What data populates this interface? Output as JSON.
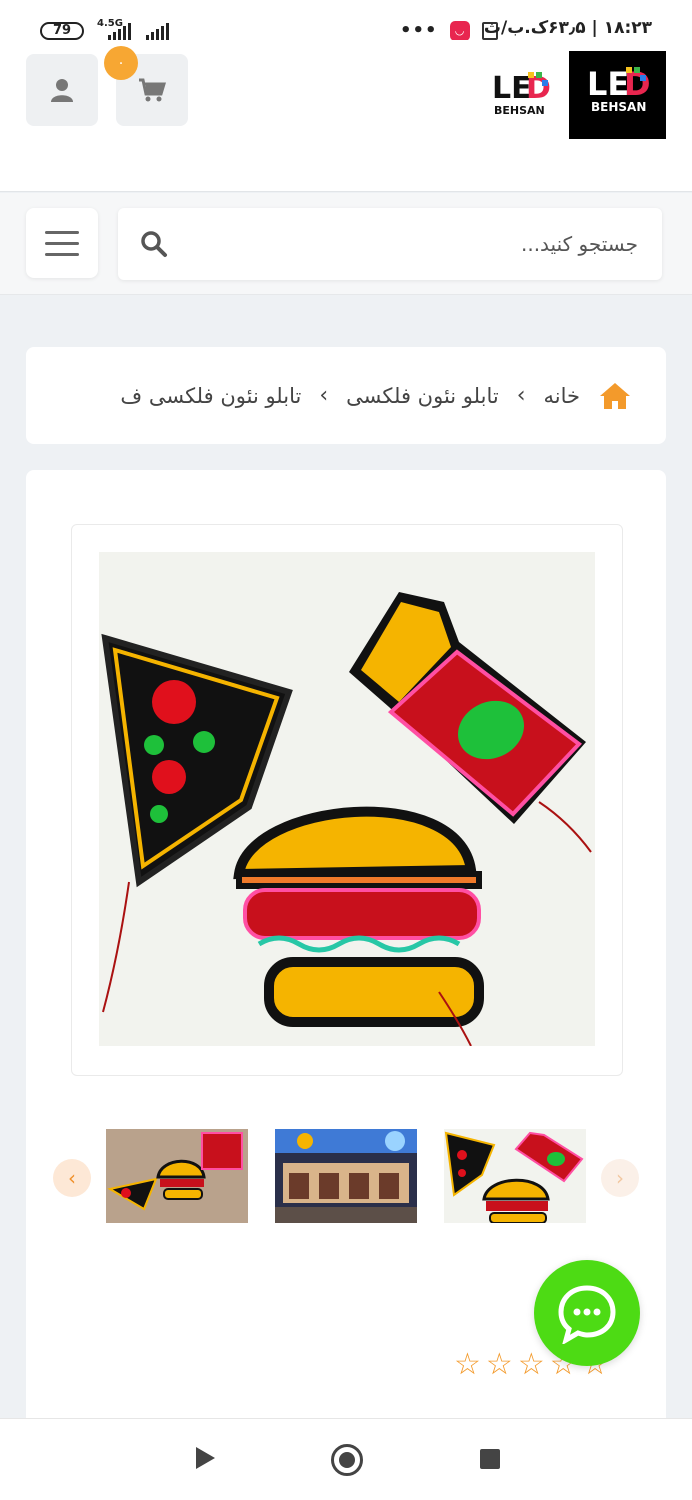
{
  "status_bar": {
    "battery": "79",
    "network": "4.5G",
    "time_info": "۱۸:۲۳ | ۶۳٫۵ک.ب/ث",
    "more": "•••"
  },
  "header": {
    "cart_count": "۰",
    "logo_text_top": "LED",
    "logo_text_bottom": "BEHSAN"
  },
  "search": {
    "placeholder": "جستجو کنید..."
  },
  "breadcrumb": {
    "items": [
      "خانه",
      "تابلو نئون فلکسی",
      "تابلو نئون فلکسی ف"
    ]
  },
  "product": {
    "image_alt": "neon pizza burger fries signs",
    "thumbnails": [
      "thumbnail-1",
      "thumbnail-2",
      "thumbnail-3"
    ],
    "rating": 0,
    "rating_max": 5
  },
  "colors": {
    "accent": "#f7a733",
    "chat": "#4ddb14"
  }
}
